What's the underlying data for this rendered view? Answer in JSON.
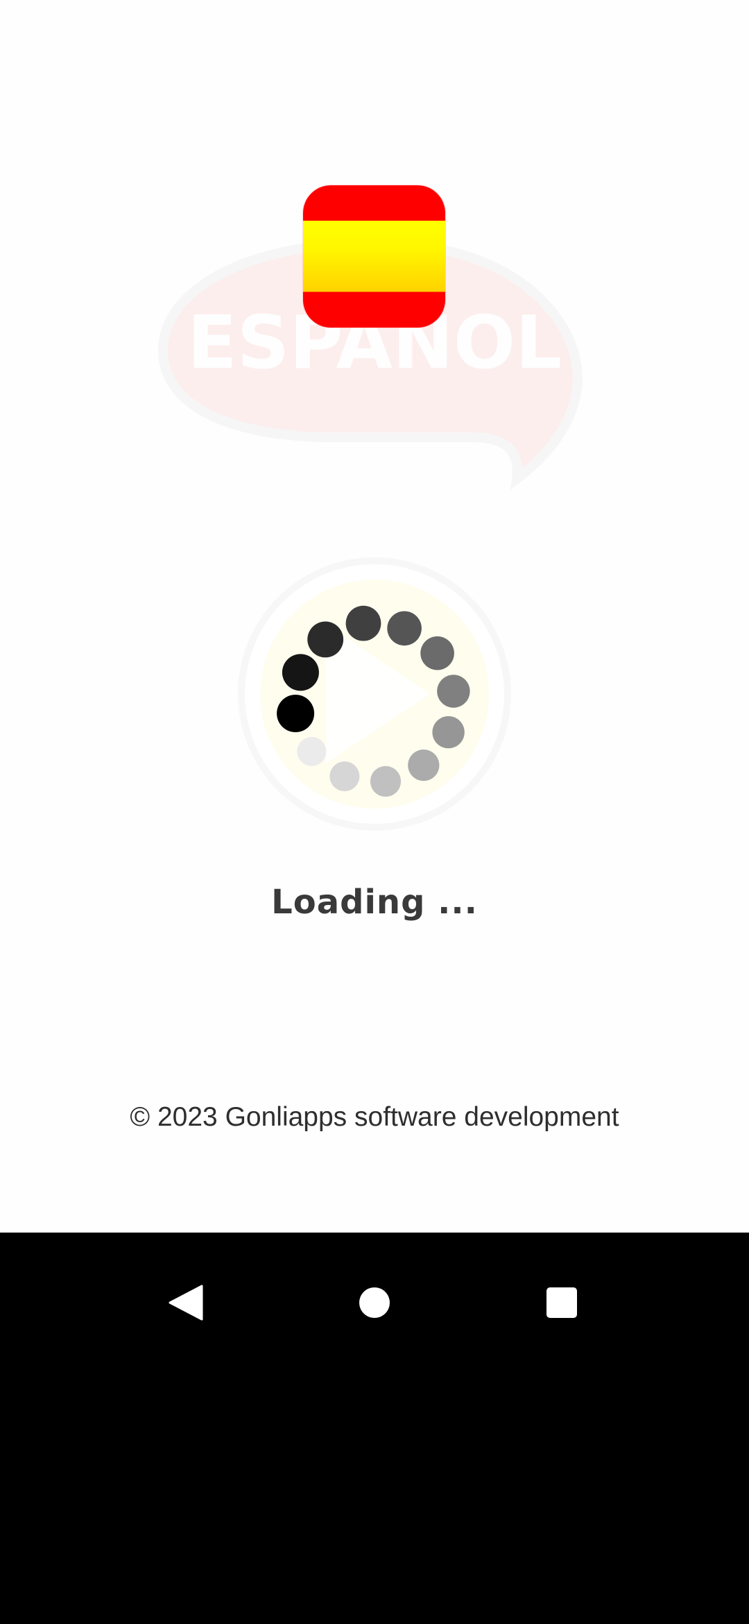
{
  "splash": {
    "watermark_text": "ESPAÑOL",
    "flag_icon": "spain-flag-icon",
    "loading_text": "Loading ...",
    "copyright": "© 2023 Gonliapps software development"
  },
  "navbar": {
    "back_icon": "back-triangle-icon",
    "home_icon": "home-circle-icon",
    "recents_icon": "recents-square-icon"
  },
  "colors": {
    "flag_red": "#ff0000",
    "flag_yellow": "#ffee00",
    "navbar_bg": "#000000",
    "text_dark": "#3a3a3a"
  }
}
